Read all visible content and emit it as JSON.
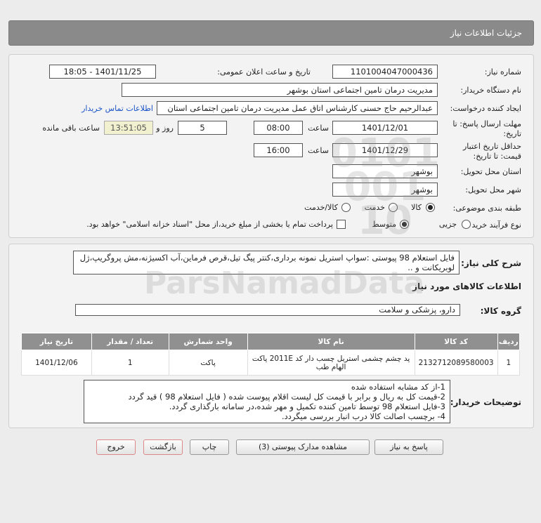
{
  "header": {
    "title": "جزئیات اطلاعات نیاز"
  },
  "form": {
    "need_number_label": "شماره نیاز:",
    "need_number": "1101004047000436",
    "announce_label": "تاریخ و ساعت اعلان عمومی:",
    "announce_value": "1401/11/25 - 18:05",
    "buyer_org_label": "نام دستگاه خریدار:",
    "buyer_org": "مدیریت درمان تامین اجتماعی استان بوشهر",
    "creator_label": "ایجاد کننده درخواست:",
    "creator": "عبدالرحیم حاج حسنی کارشناس اتاق عمل مدیریت درمان تامین اجتماعی استان",
    "contact_link": "اطلاعات تماس خریدار",
    "deadline_label_1": "مهلت ارسال پاسخ: تا",
    "deadline_label_2": "تاریخ:",
    "deadline_date": "1401/12/01",
    "time_label": "ساعت",
    "deadline_time": "08:00",
    "days": "5",
    "days_label": "روز و",
    "remaining_time": "13:51:05",
    "remaining_label": "ساعت باقی مانده",
    "validity_label_1": "حداقل تاریخ اعتبار",
    "validity_label_2": "قیمت: تا تاریخ:",
    "validity_date": "1401/12/29",
    "validity_time": "16:00",
    "province_label": "استان محل تحویل:",
    "province": "بوشهر",
    "city_label": "شهر محل تحویل:",
    "city": "بوشهر",
    "category_label": "طبقه بندی موضوعی:",
    "category_options": [
      "کالا",
      "خدمت",
      "کالا/خدمت"
    ],
    "purchase_type_label": "نوع فرآیند خرید :",
    "purchase_options": [
      "جزیی",
      "متوسط"
    ],
    "purchase_note": "پرداخت تمام یا بخشی از مبلغ خرید،از محل \"اسناد خزانه اسلامی\" خواهد بود."
  },
  "details": {
    "summary_label": "شرح کلی نیاز:",
    "summary": "فایل استعلام 98 پیوستی :سواپ استریل نمونه برداری،کنتر پیگ تیل،قرص فرماین،آب اکسیژنه،مش پروگریپ،ژل لوبریکانت و ..",
    "goods_info_title": "اطلاعات کالاهای مورد نیاز",
    "goods_group_label": "گروه کالا:",
    "goods_group": "دارو، پزشکی و سلامت",
    "table": {
      "headers": [
        "ردیف",
        "کد کالا",
        "نام کالا",
        "واحد شمارش",
        "تعداد / مقدار",
        "تاریخ نیاز"
      ],
      "rows": [
        [
          "1",
          "2132712089580003",
          "پد چشم چشمی استریل چسب دار کد 2011E پاکت الهام طب",
          "پاکت",
          "1",
          "1401/12/06"
        ]
      ]
    },
    "buyer_notes_label": "توضیحات خریدار:",
    "buyer_notes": "1-از کد مشابه استفاده شده\n2-قیمت کل به ریال و برابر با قیمت کل لیست اقلام پیوست شده ( فایل استعلام 98 ) قید گردد\n3-فایل استعلام 98 توسط تامین کننده تکمیل و مهر شده،در سامانه بارگذاری گردد.\n4- برچسب اصالت کالا درب انبار بررسی میگردد."
  },
  "buttons": {
    "reply": "پاسخ به نیاز",
    "attachments": "مشاهده مدارک پیوستی (3)",
    "print": "چاپ",
    "back": "بازگشت",
    "exit": "خروج"
  },
  "watermark": {
    "brand": "ParsNamadData"
  }
}
